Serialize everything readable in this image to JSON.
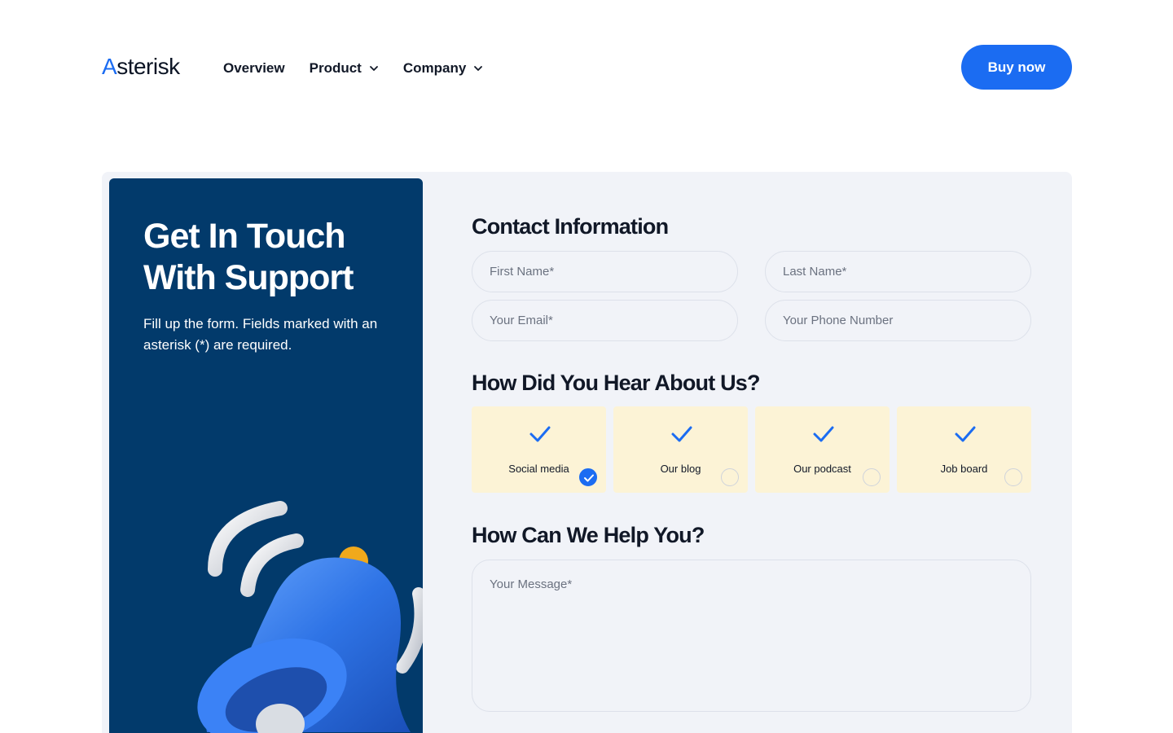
{
  "header": {
    "logo_first": "A",
    "logo_rest": "sterisk",
    "nav": [
      {
        "label": "Overview",
        "dropdown": false
      },
      {
        "label": "Product",
        "dropdown": true
      },
      {
        "label": "Company",
        "dropdown": true
      }
    ],
    "buy_label": "Buy now"
  },
  "side": {
    "title_line1": "Get In Touch",
    "title_line2": "With Support",
    "description": "Fill up the form. Fields marked with an asterisk (*) are required."
  },
  "form": {
    "contact_title": "Contact Information",
    "first_name_placeholder": "First Name*",
    "last_name_placeholder": "Last Name*",
    "email_placeholder": "Your Email*",
    "phone_placeholder": "Your Phone Number",
    "hear_title": "How Did You Hear About Us?",
    "options": [
      {
        "label": "Social media",
        "selected": true
      },
      {
        "label": "Our blog",
        "selected": false
      },
      {
        "label": "Our podcast",
        "selected": false
      },
      {
        "label": "Job board",
        "selected": false
      }
    ],
    "help_title": "How Can We Help You?",
    "message_placeholder": "Your Message*"
  },
  "colors": {
    "accent": "#1b6cf2",
    "side_bg": "#023a6b",
    "card_bg": "#f1f3f8",
    "option_bg": "#fcf3d6"
  }
}
